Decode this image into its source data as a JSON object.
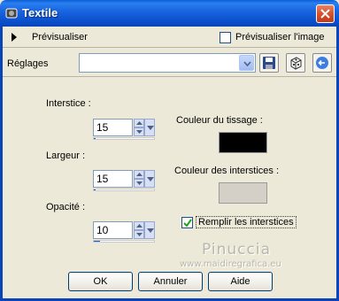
{
  "window": {
    "title": "Textile"
  },
  "preview": {
    "label": "Prévisualiser",
    "image_checkbox_label": "Prévisualiser l'image",
    "image_checked": false
  },
  "settings": {
    "label": "Réglages",
    "value": ""
  },
  "fields": {
    "interstice": {
      "label": "Interstice :",
      "value": "15",
      "level": 0.03
    },
    "largeur": {
      "label": "Largeur :",
      "value": "15",
      "level": 0.03
    },
    "opacite": {
      "label": "Opacité :",
      "value": "10",
      "level": 0.1
    }
  },
  "colors": {
    "tissage": {
      "label": "Couleur du tissage :",
      "value": "#000000"
    },
    "interstices": {
      "label": "Couleur des interstices :",
      "value": "#d4d0c8"
    }
  },
  "fill": {
    "label": "Remplir les interstices",
    "checked": true
  },
  "watermark": {
    "line1": "Pinuccia",
    "line2": "www.maidiregrafica.eu"
  },
  "buttons": {
    "ok": "OK",
    "cancel": "Annuler",
    "help": "Aide"
  }
}
